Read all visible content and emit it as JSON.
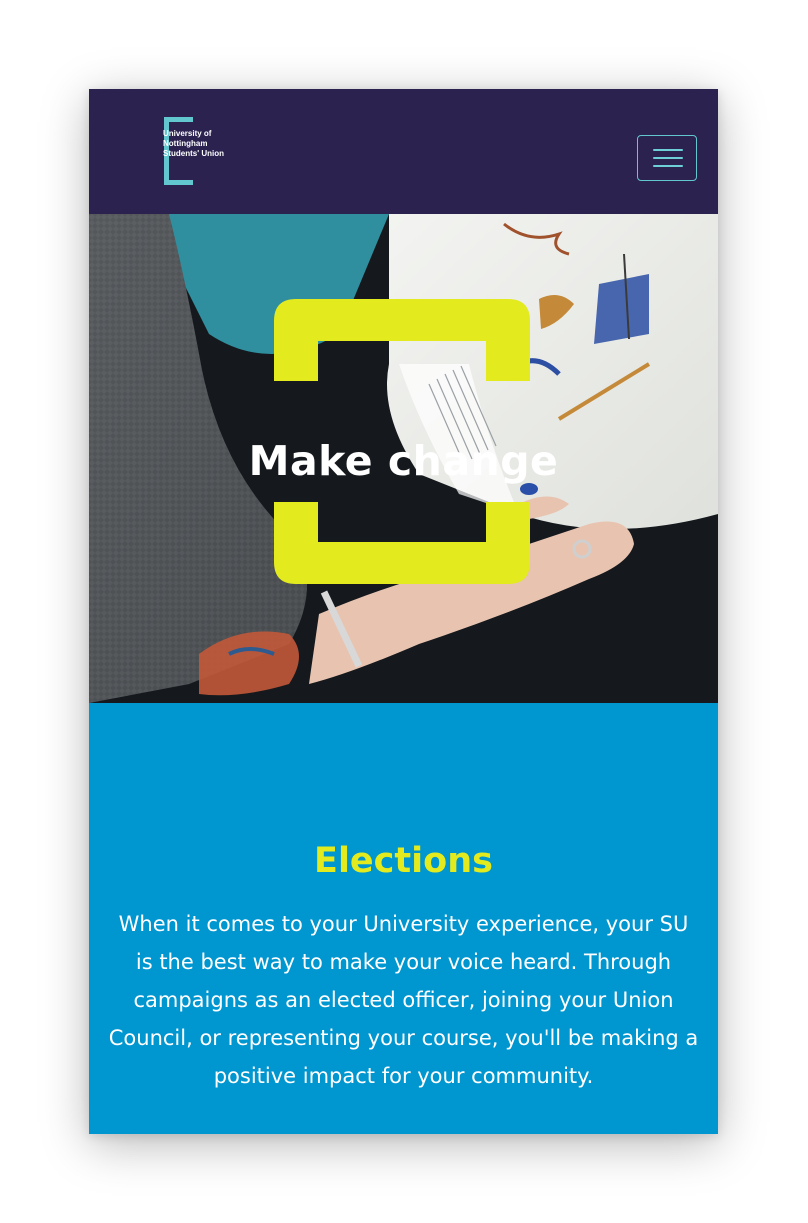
{
  "header": {
    "logo_lines": [
      "University of",
      "Nottingham",
      "Students' Union"
    ],
    "menu_icon": "hamburger-menu-icon"
  },
  "hero": {
    "title": "Make change",
    "bracket_color": "#e3ea1e"
  },
  "section": {
    "title": "Elections",
    "body": "When it comes to your University experience, your SU is the best way to make your voice heard. Through campaigns as an elected officer, joining your Union Council, or representing your course, you'll be making a positive impact for your community."
  },
  "colors": {
    "header_bg": "#2b2250",
    "accent_teal": "#63c7cf",
    "accent_yellow": "#e3ea1e",
    "section_bg": "#0096cf"
  }
}
